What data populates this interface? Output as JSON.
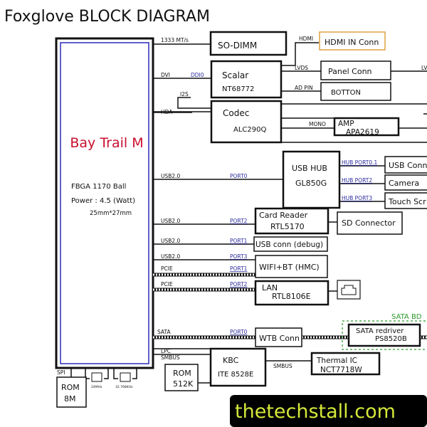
{
  "title": "Foxglove  BLOCK DIAGRAM",
  "cpu": {
    "name": "Bay Trail M",
    "package": "FBGA 1170 Ball",
    "power": "Power : 4.5  (Watt)",
    "size": "25mm*27mm",
    "name_color": "#c8102e",
    "inner_border_color": "#2a2ab8"
  },
  "blocks": {
    "sodimm": "SO-DIMM",
    "scalar": [
      "Scalar",
      "NT68772"
    ],
    "hdmi_in": "HDMI IN Conn",
    "panel": "Panel Conn",
    "botton": "BOTTON",
    "codec": [
      "Codec",
      "ALC290Q"
    ],
    "amp": [
      "AMP",
      "APA2619"
    ],
    "usb_hub": [
      "USB HUB",
      "GL850G"
    ],
    "usb_conn": "USB Conn",
    "camera": "Camera",
    "touch": "Touch Scr",
    "card_reader": [
      "Card Reader",
      "RTL5170"
    ],
    "sd": "SD Connector",
    "usb_debug": "USB conn (debug)",
    "wifi": "WIFI+BT (HMC)",
    "lan": [
      "LAN",
      "RTL8106E"
    ],
    "wtb": "WTB Conn",
    "sata_redriver": [
      "SATA redriver",
      "PS8520B"
    ],
    "sata_bd": "SATA BD",
    "kbc": [
      "KBC",
      "ITE 8528E"
    ],
    "thermal": [
      "Thermal IC",
      "NCT7718W"
    ],
    "rom512": [
      "ROM",
      "512K"
    ],
    "rom8m": [
      "ROM",
      "8M"
    ],
    "hdmi_border_color": "#e0a040",
    "sata_bd_color": "#2a9a2a"
  },
  "signals": {
    "mem": "1333 MT/s",
    "dvi": "DVI",
    "ddi0": "DDI0",
    "i2s": "I2S",
    "hda": "HDA",
    "hdmi": "HDMI",
    "lvds": "LVDS",
    "lvds_out": "LV",
    "ad_pin": "AD PIN",
    "mono": "MONO",
    "usb_hub_bus": "USB2.0",
    "usb_hub_port": "PORT0",
    "hub_port01": "HUB PORT0.1",
    "hub_port2": "HUB PORT2",
    "hub_port3": "HUB PORT3",
    "cr_bus": "USB2.0",
    "cr_port": "PORT2",
    "dbg_bus": "USB2.0",
    "dbg_port": "PORT1",
    "usb3_bus": "USB2.0",
    "usb3_port": "PORT3",
    "wifi_bus": "PCIE",
    "wifi_port": "PORT1",
    "lan_bus": "PCIE",
    "lan_port": "PORT2",
    "sata_bus": "SATA",
    "sata_port": "PORT0",
    "lpc": "LPC",
    "smbus": "SMBUS",
    "smbus2": "SMBUS",
    "spi": "SPI",
    "xtal1": "24MHz",
    "xtal2": "32.768KHz"
  },
  "watermark": {
    "text": "thetechstall.com",
    "text_color": "#d4e83a",
    "bg_color": "#000000"
  }
}
